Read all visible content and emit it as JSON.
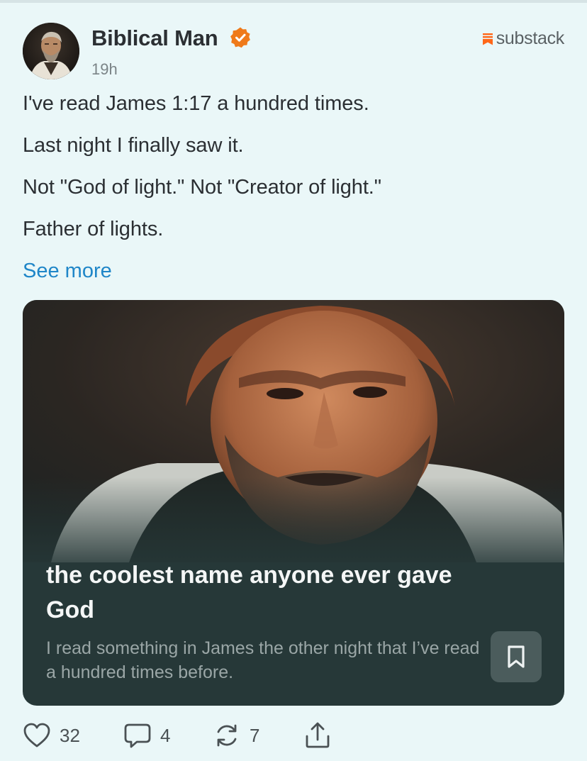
{
  "post": {
    "author_name": "Biblical Man",
    "time_ago": "19h",
    "platform_label": "substack",
    "paragraphs": [
      "I've read James 1:17 a hundred times.",
      "Last night I finally saw it.",
      "Not \"God of light.\" Not \"Creator of light.\"",
      "Father of lights."
    ],
    "see_more_label": "See more"
  },
  "card": {
    "title": "the coolest name anyone ever gave God",
    "description": "I read something in James the other night that I’ve read a hundred times before."
  },
  "actions": {
    "likes": "32",
    "comments": "4",
    "restacks": "7"
  },
  "colors": {
    "background": "#eaf7f8",
    "link": "#1f86c8",
    "verified_badge": "#ef7a1a",
    "substack_brand": "#ff6719",
    "card_background": "#263838"
  },
  "icons": [
    "verified-badge-icon",
    "substack-logo-icon",
    "bookmark-icon",
    "heart-icon",
    "comment-icon",
    "restack-icon",
    "share-icon"
  ]
}
